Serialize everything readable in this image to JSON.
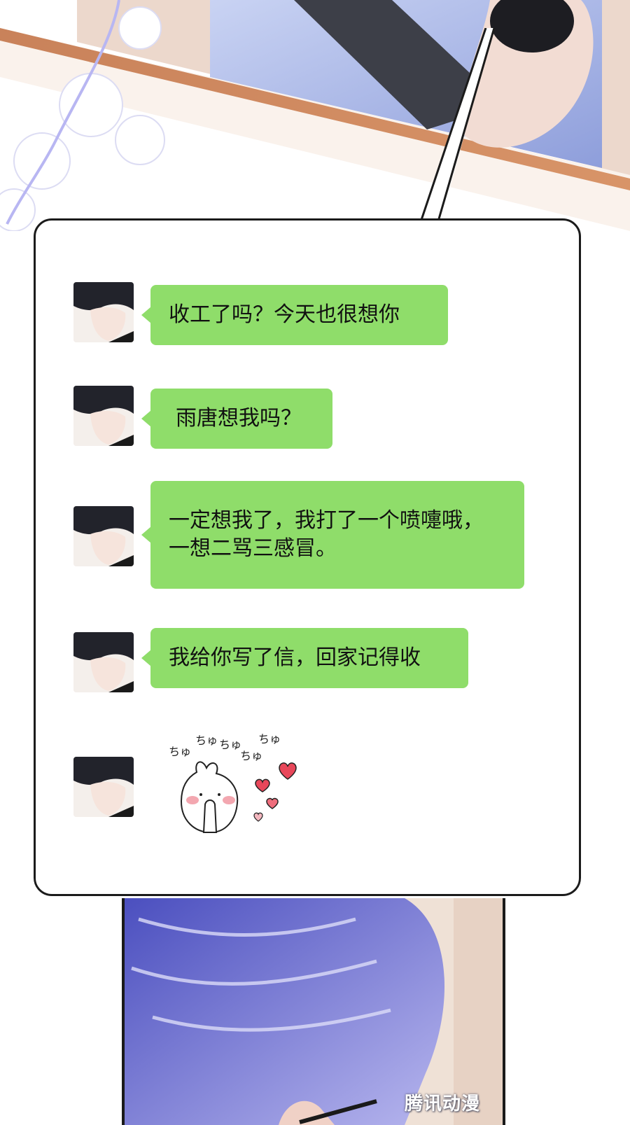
{
  "messages": [
    {
      "text": "收工了吗？今天也很想你"
    },
    {
      "text": "雨唐想我吗？"
    },
    {
      "text": "一定想我了，我打了一个喷嚏哦，\n一想二骂三感冒。"
    },
    {
      "text": "我给你写了信，回家记得收"
    }
  ],
  "sticker": {
    "sound_effects": [
      "ちゅ",
      "ちゅ",
      "ちゅ",
      "ちゅ",
      "ちゅ"
    ]
  },
  "watermark": "腾讯动漫",
  "colors": {
    "bubble_green": "#8fdd6a",
    "panel_border": "#1b1b1b",
    "heart_red": "#e8475a"
  }
}
